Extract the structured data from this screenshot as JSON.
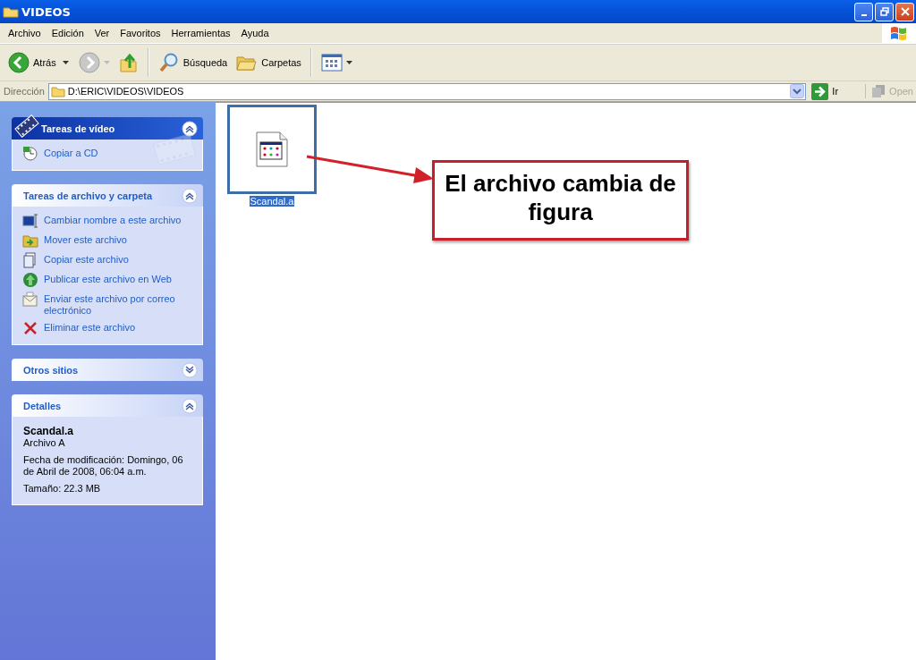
{
  "window": {
    "title": "VIDEOS"
  },
  "menu": [
    {
      "label": "Archivo"
    },
    {
      "label": "Edición"
    },
    {
      "label": "Ver"
    },
    {
      "label": "Favoritos"
    },
    {
      "label": "Herramientas"
    },
    {
      "label": "Ayuda"
    }
  ],
  "toolbar": {
    "back": "Atrás",
    "forward_disabled": true,
    "search": "Búsqueda",
    "folders": "Carpetas"
  },
  "address": {
    "label": "Dirección",
    "value": "D:\\ERIC\\VIDEOS\\VIDEOS",
    "go": "Ir",
    "open": "Open",
    "open_disabled": true
  },
  "panels": [
    {
      "kind": "special",
      "title": "Tareas de vídeo",
      "expanded": true,
      "items": [
        {
          "label": "Copiar a CD"
        }
      ]
    },
    {
      "kind": "tasks",
      "title": "Tareas de archivo y carpeta",
      "expanded": true,
      "items": [
        {
          "label": "Cambiar nombre a este archivo"
        },
        {
          "label": "Mover este archivo"
        },
        {
          "label": "Copiar este archivo"
        },
        {
          "label": "Publicar este archivo en Web"
        },
        {
          "label": "Enviar este archivo por correo electrónico"
        },
        {
          "label": "Eliminar este archivo"
        }
      ]
    },
    {
      "kind": "tasks",
      "title": "Otros sitios",
      "expanded": false
    },
    {
      "kind": "details",
      "title": "Detalles",
      "expanded": true,
      "name": "Scandal.a",
      "type": "Archivo A",
      "modified": "Fecha de modificación: Domingo, 06 de Abril de 2008, 06:04 a.m.",
      "size": "Tamaño: 22.3 MB"
    }
  ],
  "files": [
    {
      "name": "Scandal.a",
      "selected": true
    }
  ],
  "annotation": {
    "text": "El archivo cambia de figura"
  }
}
